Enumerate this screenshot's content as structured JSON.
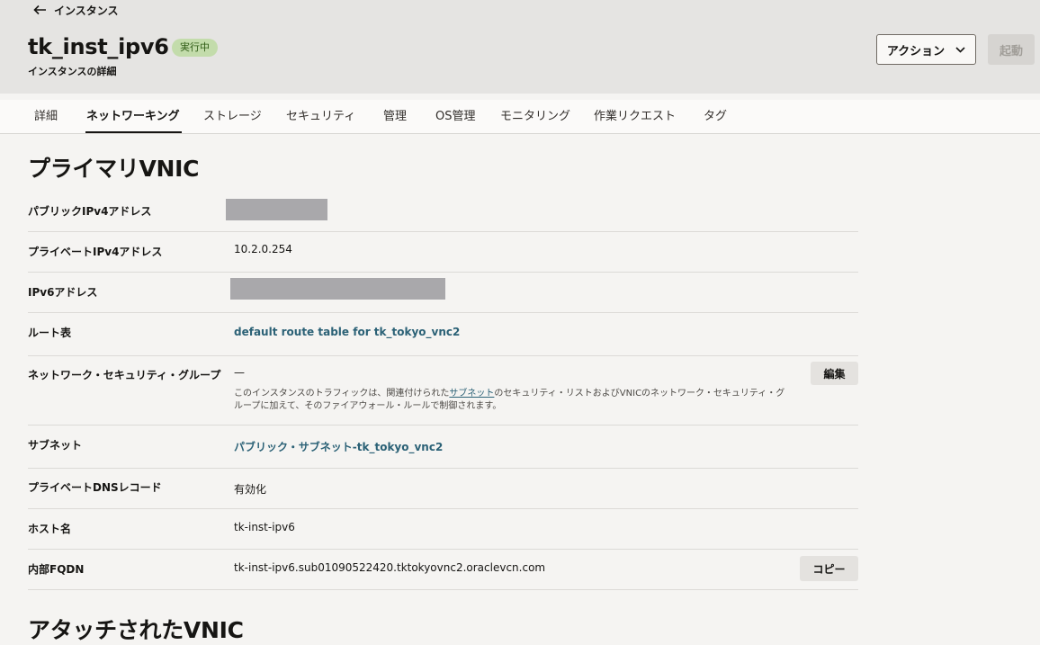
{
  "header": {
    "back_label": "インスタンス",
    "title": "tk_inst_ipv6",
    "status_badge": "実行中",
    "subtitle": "インスタンスの詳細",
    "actions_label": "アクション",
    "start_label": "起動"
  },
  "tabs": [
    {
      "label": "詳細"
    },
    {
      "label": "ネットワーキング",
      "active": true
    },
    {
      "label": "ストレージ"
    },
    {
      "label": "セキュリティ"
    },
    {
      "label": "管理"
    },
    {
      "label": "OS管理"
    },
    {
      "label": "モニタリング"
    },
    {
      "label": "作業リクエスト"
    },
    {
      "label": "タグ"
    }
  ],
  "primary_vnic": {
    "title": "プライマリVNIC",
    "rows": {
      "public_ipv4": {
        "label": "パブリックIPv4アドレス",
        "value": ""
      },
      "private_ipv4": {
        "label": "プライベートIPv4アドレス",
        "value": "10.2.0.254"
      },
      "ipv6": {
        "label": "IPv6アドレス",
        "value": ""
      },
      "route_table": {
        "label": "ルート表",
        "value": "default route table for tk_tokyo_vnc2"
      },
      "nsg": {
        "label": "ネットワーク・セキュリティ・グループ",
        "value": "—",
        "edit_label": "編集",
        "help_prefix": "このインスタンスのトラフィックは、関連付けられた",
        "help_link": "サブネット",
        "help_suffix": "のセキュリティ・リストおよびVNICのネットワーク・セキュリティ・グループに加えて、そのファイアウォール・ルールで制御されます。"
      },
      "subnet": {
        "label": "サブネット",
        "value": "パブリック・サブネット-tk_tokyo_vnc2"
      },
      "private_dns": {
        "label": "プライベートDNSレコード",
        "value": "有効化"
      },
      "hostname": {
        "label": "ホスト名",
        "value": "tk-inst-ipv6"
      },
      "internal_fqdn": {
        "label": "内部FQDN",
        "value": "tk-inst-ipv6.sub01090522420.tktokyovnc2.oraclevcn.com",
        "copy_label": "コピー"
      }
    }
  },
  "attached_vnics": {
    "title": "アタッチされたVNIC"
  },
  "colors": {
    "badge_bg": "#c3dcab",
    "link": "#2b6176",
    "redaction": "#a9a8ab"
  }
}
